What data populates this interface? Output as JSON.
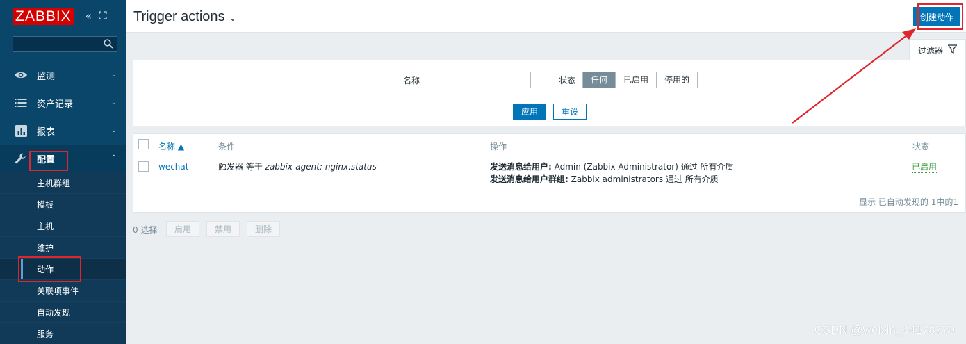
{
  "sidebar": {
    "logo": "ZABBIX",
    "collapse_icon": "collapse-icon",
    "kiosk_icon": "kiosk-icon",
    "search_placeholder": "",
    "menu": [
      {
        "label": "监测",
        "icon": "eye-icon"
      },
      {
        "label": "资产记录",
        "icon": "list-icon"
      },
      {
        "label": "报表",
        "icon": "chart-icon"
      },
      {
        "label": "配置",
        "icon": "wrench-icon"
      }
    ],
    "submenu": [
      "主机群组",
      "模板",
      "主机",
      "维护",
      "动作",
      "关联项事件",
      "自动发现",
      "服务"
    ]
  },
  "header": {
    "title": "Trigger actions",
    "create_button": "创建动作"
  },
  "filter": {
    "tab_label": "过滤器",
    "name_label": "名称",
    "name_value": "",
    "status_label": "状态",
    "status_options": [
      "任何",
      "已启用",
      "停用的"
    ],
    "status_selected": "任何",
    "apply": "应用",
    "reset": "重设"
  },
  "table": {
    "headers": {
      "name": "名称 ▲",
      "conditions": "条件",
      "operations": "操作",
      "status": "状态"
    },
    "rows": [
      {
        "name": "wechat",
        "condition_prefix": "触发器 等于 ",
        "condition_value": "zabbix-agent: nginx.status",
        "op1_label": "发送消息给用户:",
        "op1_value": " Admin (Zabbix Administrator) 通过 所有介质",
        "op2_label": "发送消息给用户群组:",
        "op2_value": " Zabbix administrators 通过 所有介质",
        "status": "已启用"
      }
    ],
    "footer": "显示 已自动发现的 1中的1"
  },
  "bulk": {
    "selected": "0 选择",
    "enable": "启用",
    "disable": "禁用",
    "delete": "删除"
  },
  "watermark": "CSDN @weixin_44178770",
  "colors": {
    "accent": "#0275b8",
    "sidebar": "#0a466a",
    "annotation": "#e0262d",
    "enabled": "#429e47"
  }
}
